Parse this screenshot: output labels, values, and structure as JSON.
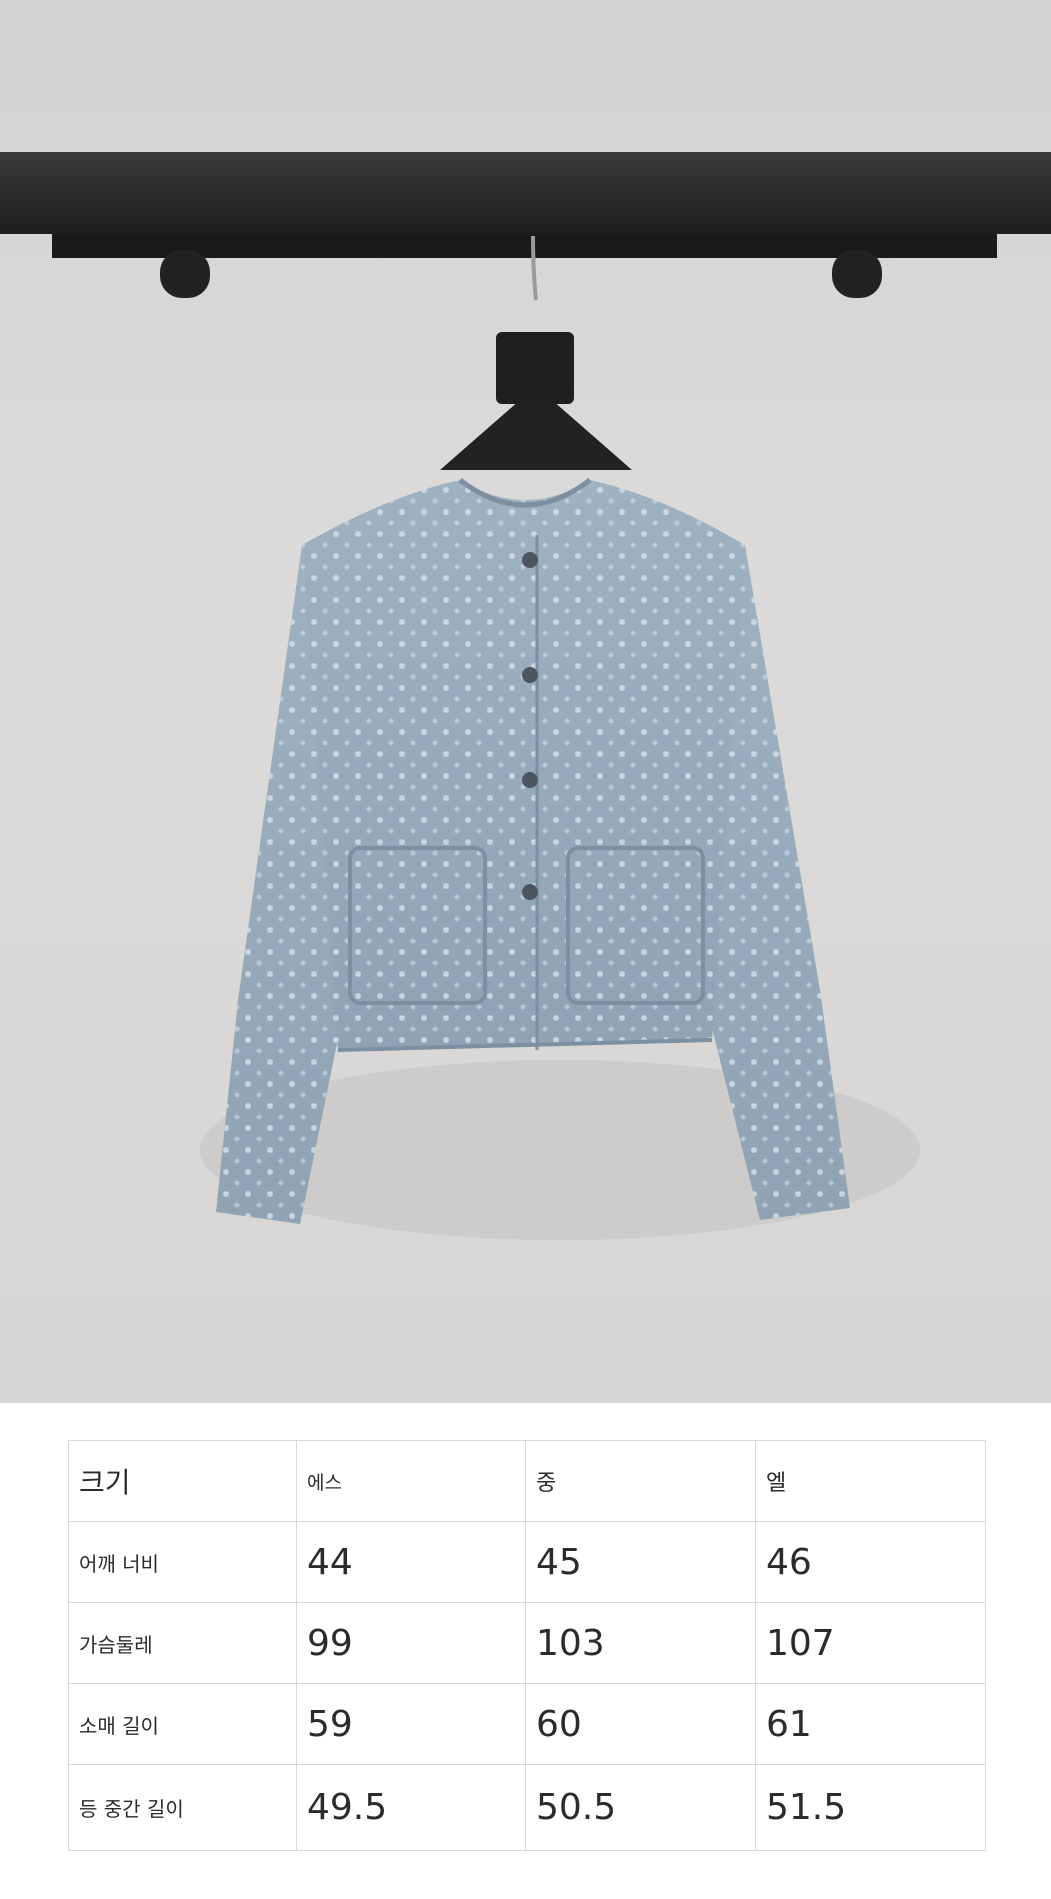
{
  "size_table": {
    "header": {
      "label": "크기",
      "sizes": [
        "에스",
        "중",
        "엘"
      ]
    },
    "rows": [
      {
        "label": "어깨 너비",
        "values": [
          "44",
          "45",
          "46"
        ]
      },
      {
        "label": "가슴둘레",
        "values": [
          "99",
          "103",
          "107"
        ]
      },
      {
        "label": "소매 길이",
        "values": [
          "59",
          "60",
          "61"
        ]
      },
      {
        "label": "등 중간 길이",
        "values": [
          "49.5",
          "50.5",
          "51.5"
        ]
      }
    ]
  }
}
